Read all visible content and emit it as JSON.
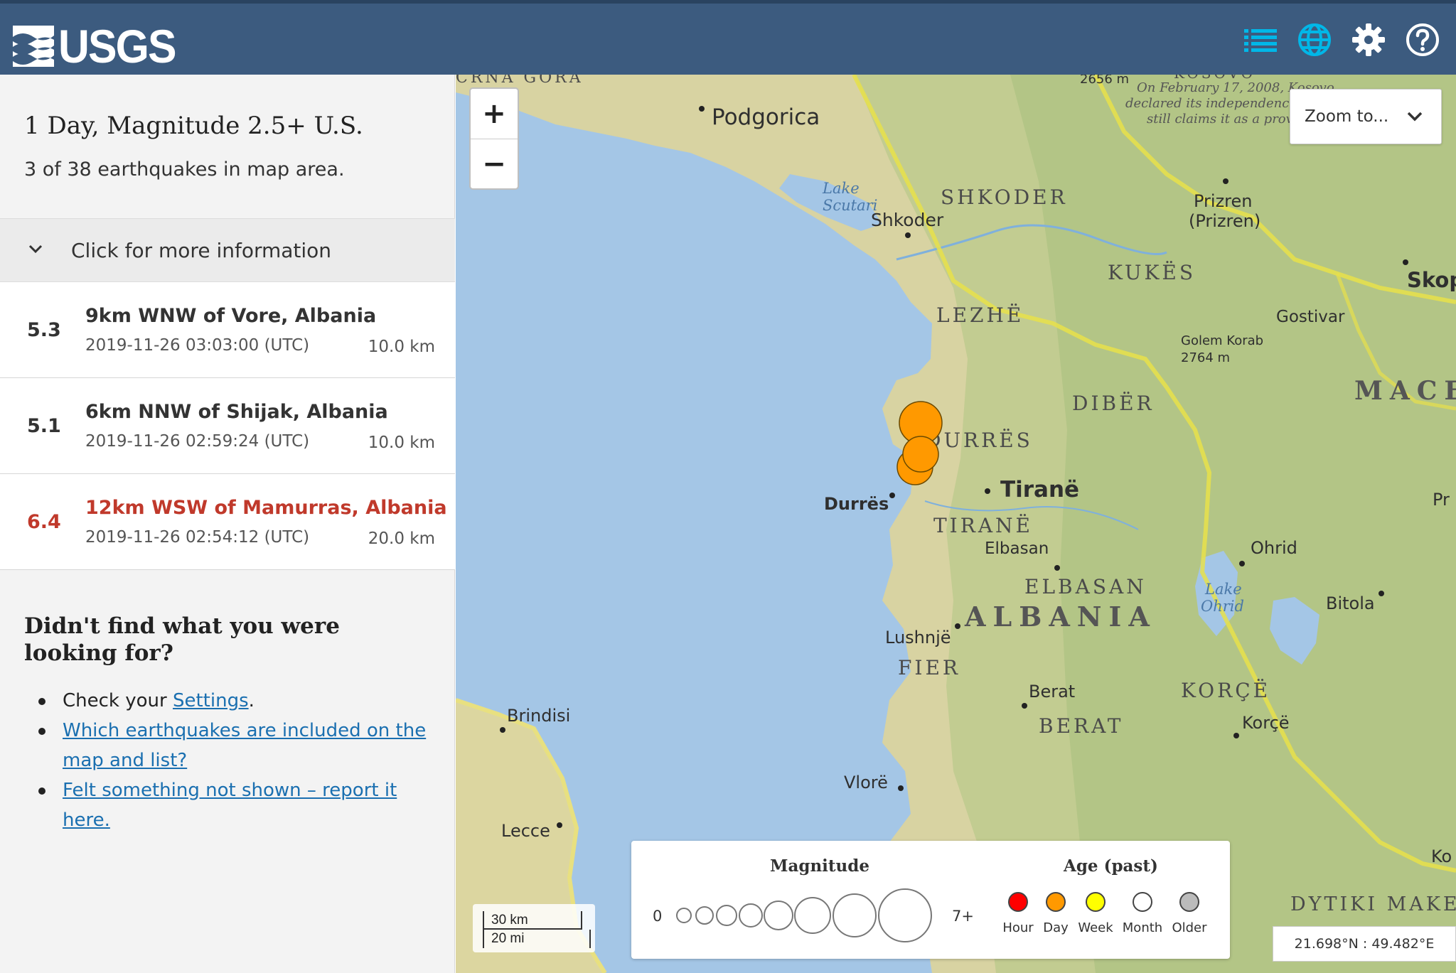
{
  "header": {
    "logo_text": "USGS",
    "icons": [
      "list-icon",
      "globe-icon",
      "gear-icon",
      "help-icon"
    ],
    "accent_color": "#3c5b7f",
    "icon_color": "#00b7e8"
  },
  "sidebar": {
    "title": "1 Day, Magnitude 2.5+ U.S.",
    "count_text": "3 of 38 earthquakes in map area.",
    "more_info_label": "Click for more information",
    "earthquakes": [
      {
        "mag": "5.3",
        "place": "9km WNW of Vore, Albania",
        "time": "2019-11-26 03:03:00 (UTC)",
        "depth": "10.0 km"
      },
      {
        "mag": "5.1",
        "place": "6km NNW of Shijak, Albania",
        "time": "2019-11-26 02:59:24 (UTC)",
        "depth": "10.0 km"
      },
      {
        "mag": "6.4",
        "place": "12km WSW of Mamurras, Albania",
        "time": "2019-11-26 02:54:12 (UTC)",
        "depth": "20.0 km",
        "highlight_color": "#c0392b"
      }
    ],
    "help": {
      "title": "Didn't find what you were looking for?",
      "item1_prefix": "Check your ",
      "item1_link": "Settings",
      "item1_suffix": ".",
      "item2_link": "Which earthquakes are included on the map and list?",
      "item3_link": "Felt something not shown – report it here."
    }
  },
  "map": {
    "zoom_in": "+",
    "zoom_out": "−",
    "zoom_to_label": "Zoom to...",
    "labels": {
      "montenegro_partial": "CRNA GORA",
      "podgorica": "Podgorica",
      "elev_top": "2656 m",
      "kosovo_partial": "KOSOVO",
      "note1": "On February 17, 2008, Kosovo",
      "note2": "declared its independence",
      "note3": "still claims it as a prov",
      "lake_scutari1": "Lake",
      "lake_scutari2": "Scutari",
      "shkoder_region": "SHKODER",
      "shkoder_city": "Shkoder",
      "prizren1": "Prizren",
      "prizren2": "(Prizren)",
      "kukes": "KUKËS",
      "skop": "Skop",
      "lezhe": "LEZHË",
      "gostivar": "Gostivar",
      "golem1": "Golem Korab",
      "golem2": "2764 m",
      "mace": "MACE",
      "diber": "DIBËR",
      "durres_region": "DURRËS",
      "tirane_city": "Tiranë",
      "pr": "Pr",
      "durres_city": "Durrës",
      "tirane_region": "TIRANË",
      "elbasan_city": "Elbasan",
      "ohrid": "Ohrid",
      "elbasan_region": "ELBASAN",
      "lake_ohrid1": "Lake",
      "lake_ohrid2": "Ohrid",
      "bitola": "Bitola",
      "albania": "ALBANIA",
      "lushnje": "Lushnjë",
      "fier": "FIER",
      "berat_city": "Berat",
      "korce_region": "KORÇË",
      "brindisi": "Brindisi",
      "korce_city": "Korçë",
      "berat_region": "BERAT",
      "vlore": "Vlorë",
      "lecce": "Lecce",
      "ko": "Ko",
      "dytiki": "DYTIKI MAKE"
    },
    "earthquake_markers": [
      {
        "mag": 5.3,
        "color": "#ff9900"
      },
      {
        "mag": 5.1,
        "color": "#ff9900"
      },
      {
        "mag": 6.4,
        "color": "#ff9900"
      }
    ],
    "scale": {
      "km": "30 km",
      "mi": "20 mi"
    },
    "legend": {
      "magnitude_title": "Magnitude",
      "mag_min": "0",
      "mag_max": "7+",
      "age_title": "Age (past)",
      "ages": [
        {
          "label": "Hour",
          "color": "#ff0000"
        },
        {
          "label": "Day",
          "color": "#ff9900"
        },
        {
          "label": "Week",
          "color": "#ffff00"
        },
        {
          "label": "Month",
          "color": "#ffffff"
        },
        {
          "label": "Older",
          "color": "#bbbbbb"
        }
      ]
    },
    "coordinates": "21.698°N : 49.482°E"
  }
}
